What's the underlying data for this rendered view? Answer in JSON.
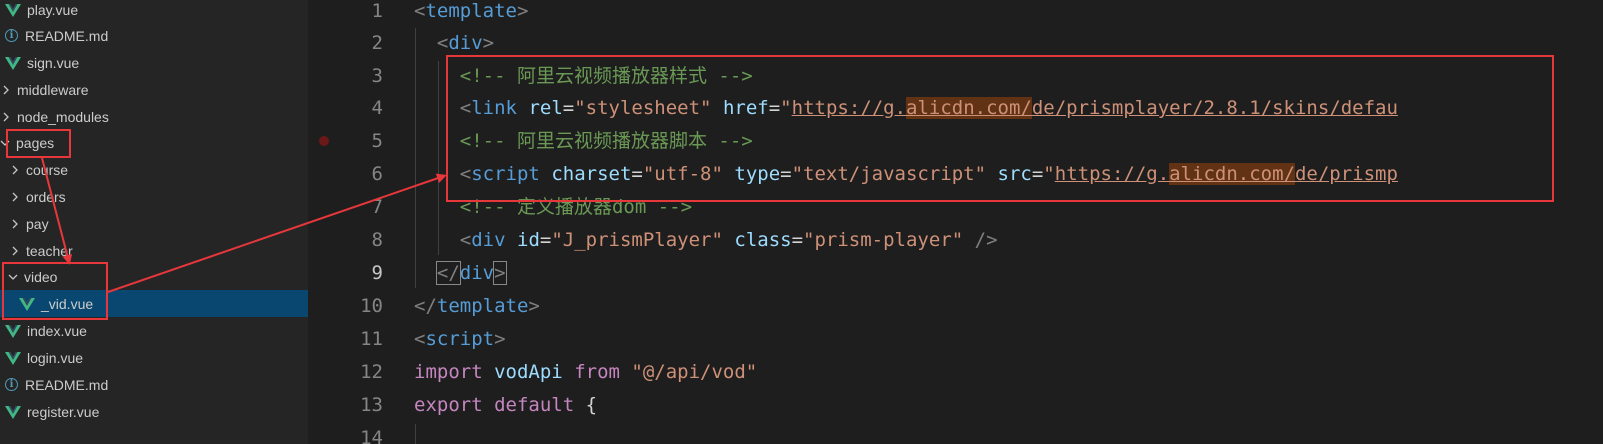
{
  "explorer": {
    "items": [
      {
        "label": "play.vue",
        "kind": "vue"
      },
      {
        "label": "README.md",
        "kind": "info"
      },
      {
        "label": "sign.vue",
        "kind": "vue"
      },
      {
        "label": "middleware",
        "kind": "folder-collapsed"
      },
      {
        "label": "node_modules",
        "kind": "folder-collapsed"
      },
      {
        "label": "pages",
        "kind": "folder-expanded"
      },
      {
        "label": "course",
        "kind": "folder-collapsed"
      },
      {
        "label": "orders",
        "kind": "folder-collapsed"
      },
      {
        "label": "pay",
        "kind": "folder-collapsed"
      },
      {
        "label": "teacher",
        "kind": "folder-collapsed"
      },
      {
        "label": "video",
        "kind": "folder-expanded"
      },
      {
        "label": "_vid.vue",
        "kind": "vue",
        "selected": true
      },
      {
        "label": "index.vue",
        "kind": "vue"
      },
      {
        "label": "login.vue",
        "kind": "vue"
      },
      {
        "label": "README.md",
        "kind": "info"
      },
      {
        "label": "register.vue",
        "kind": "vue"
      }
    ]
  },
  "editor": {
    "line_numbers": [
      "1",
      "2",
      "3",
      "4",
      "5",
      "6",
      "7",
      "8",
      "9",
      "10",
      "11",
      "12",
      "13",
      "14"
    ],
    "active_line": "9",
    "lines": {
      "l1": {
        "open": "<",
        "tag": "template",
        "close": ">"
      },
      "l2": {
        "open": "<",
        "tag": "div",
        "close": ">"
      },
      "l3": {
        "comment": "<!-- 阿里云视频播放器样式 -->"
      },
      "l4": {
        "open": "<",
        "tag": "link",
        "attr1": "rel",
        "eq": "=",
        "val1": "\"stylesheet\"",
        "attr2": "href",
        "q": "\"",
        "url_pre": "https://g.",
        "url_hl": "alicdn.com/",
        "url_post": "de/prismplayer/2.8.1/skins/defau"
      },
      "l5": {
        "comment": "<!-- 阿里云视频播放器脚本 -->"
      },
      "l6": {
        "open": "<",
        "tag": "script",
        "attr1": "charset",
        "val1": "\"utf-8\"",
        "attr2": "type",
        "val2": "\"text/javascript\"",
        "attr3": "src",
        "q": "\"",
        "url_pre": "https://g.",
        "url_hl": "alicdn.com/",
        "url_post": "de/prismp"
      },
      "l7": {
        "comment": "<!-- 定义播放器dom -->"
      },
      "l8": {
        "open": "<",
        "tag": "div",
        "attr1": "id",
        "val1": "\"J_prismPlayer\"",
        "attr2": "class",
        "val2": "\"prism-player\"",
        "close": " />"
      },
      "l9": {
        "open": "</",
        "tag": "div",
        "close": ">"
      },
      "l10": {
        "open": "</",
        "tag": "template",
        "close": ">"
      },
      "l11": {
        "open": "<",
        "tag": "script",
        "close": ">"
      },
      "l12": {
        "kw": "import",
        "name": "vodApi",
        "from": "from",
        "str": "\"@/api/vod\""
      },
      "l13": {
        "kw": "export",
        "kw2": "default",
        "brace": "{"
      }
    }
  },
  "annotation": {
    "color": "#e8373b"
  }
}
